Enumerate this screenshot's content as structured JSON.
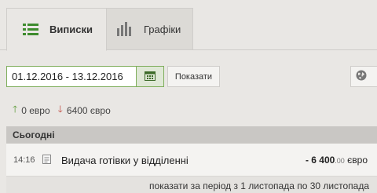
{
  "tabs": [
    {
      "label": "Виписки",
      "icon": "list-icon",
      "active": true
    },
    {
      "label": "Графіки",
      "icon": "bar-chart-icon",
      "active": false
    }
  ],
  "filter": {
    "date_range": "01.12.2016 - 13.12.2016",
    "show_label": "Показати",
    "calendar_icon": "calendar-icon",
    "globe_icon": "globe-icon"
  },
  "totals": {
    "income": "0 евро",
    "expense": "6400 євро"
  },
  "colors": {
    "accent_green": "#7fae5c",
    "income_arrow": "#5a9a35",
    "expense_arrow": "#c0443a"
  },
  "day": {
    "header": "Сьогодні",
    "transactions": [
      {
        "time": "14:16",
        "icon": "document-icon",
        "description": "Видача готівки у відділенні",
        "amount_main": "- 6 400",
        "amount_cents": ".00",
        "currency": " євро"
      }
    ]
  },
  "footer": {
    "period_link": "показати за період з 1 листопада по 30 листопада"
  }
}
